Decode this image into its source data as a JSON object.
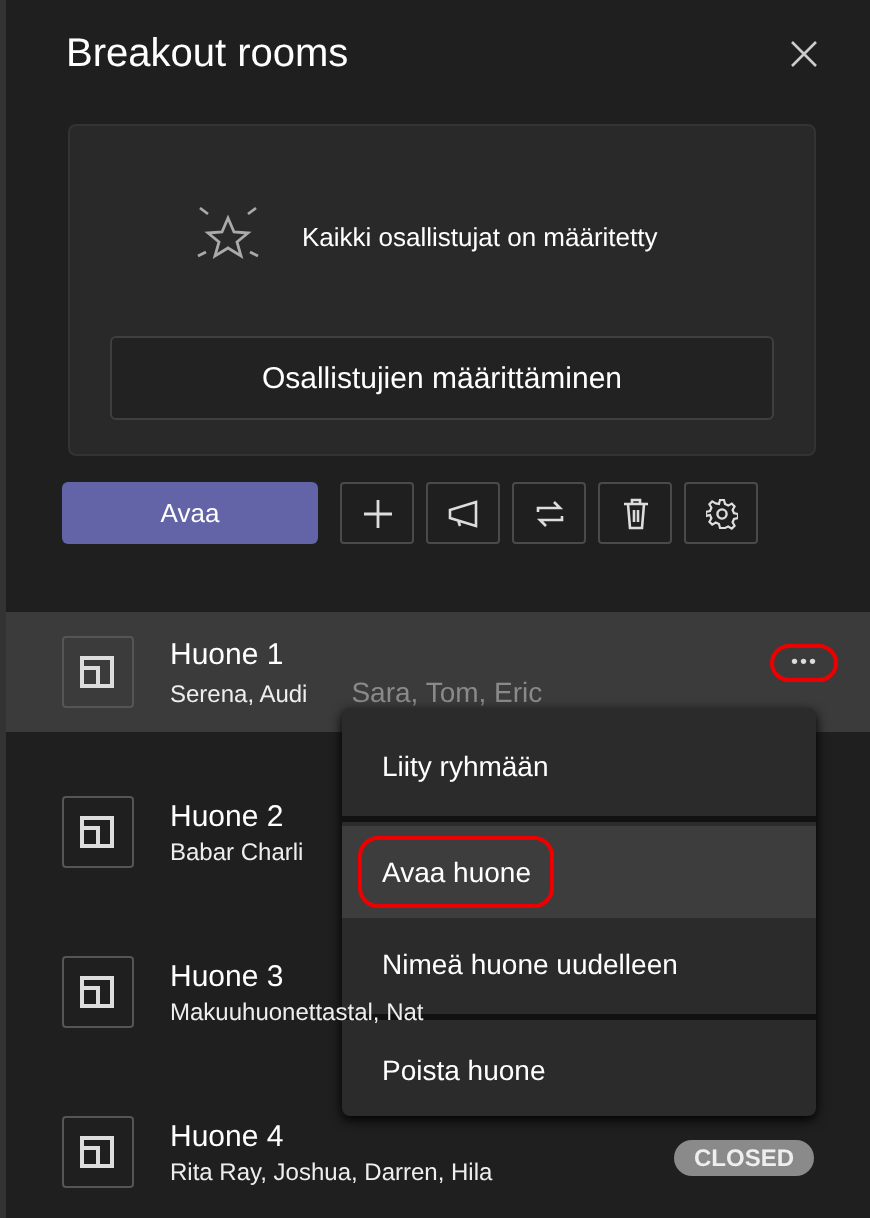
{
  "panel": {
    "title": "Breakout rooms"
  },
  "assignment": {
    "status": "Kaikki osallistujat on määritetty",
    "button": "Osallistujien määrittäminen"
  },
  "toolbar": {
    "primary": "Avaa",
    "tools": [
      {
        "kind": "add"
      },
      {
        "kind": "announce"
      },
      {
        "kind": "recreate"
      },
      {
        "kind": "delete"
      },
      {
        "kind": "settings"
      }
    ]
  },
  "rooms": [
    {
      "name": "Huone 1",
      "participants": "Serena, Audi",
      "extra": "Sara, Tom, Eric",
      "selected": true,
      "more": "•••",
      "annotated": true
    },
    {
      "name": "Huone 2",
      "participants": "Babar Charli",
      "selected": false
    },
    {
      "name": "Huone 3",
      "participants": "Makuuhuonettastal, Nat",
      "selected": false
    },
    {
      "name": "Huone 4",
      "participants": "Rita Ray, Joshua, Darren, Hila",
      "selected": false,
      "badge": "CLOSED"
    }
  ],
  "menu": {
    "items": [
      {
        "label": "Liity ryhmään",
        "selected": false,
        "annotated": false
      },
      {
        "label": "Avaa huone",
        "selected": true,
        "annotated": true
      },
      {
        "label": "Nimeä huone uudelleen",
        "selected": false,
        "annotated": false
      },
      {
        "label": "Poista huone",
        "selected": false,
        "annotated": false
      }
    ]
  }
}
